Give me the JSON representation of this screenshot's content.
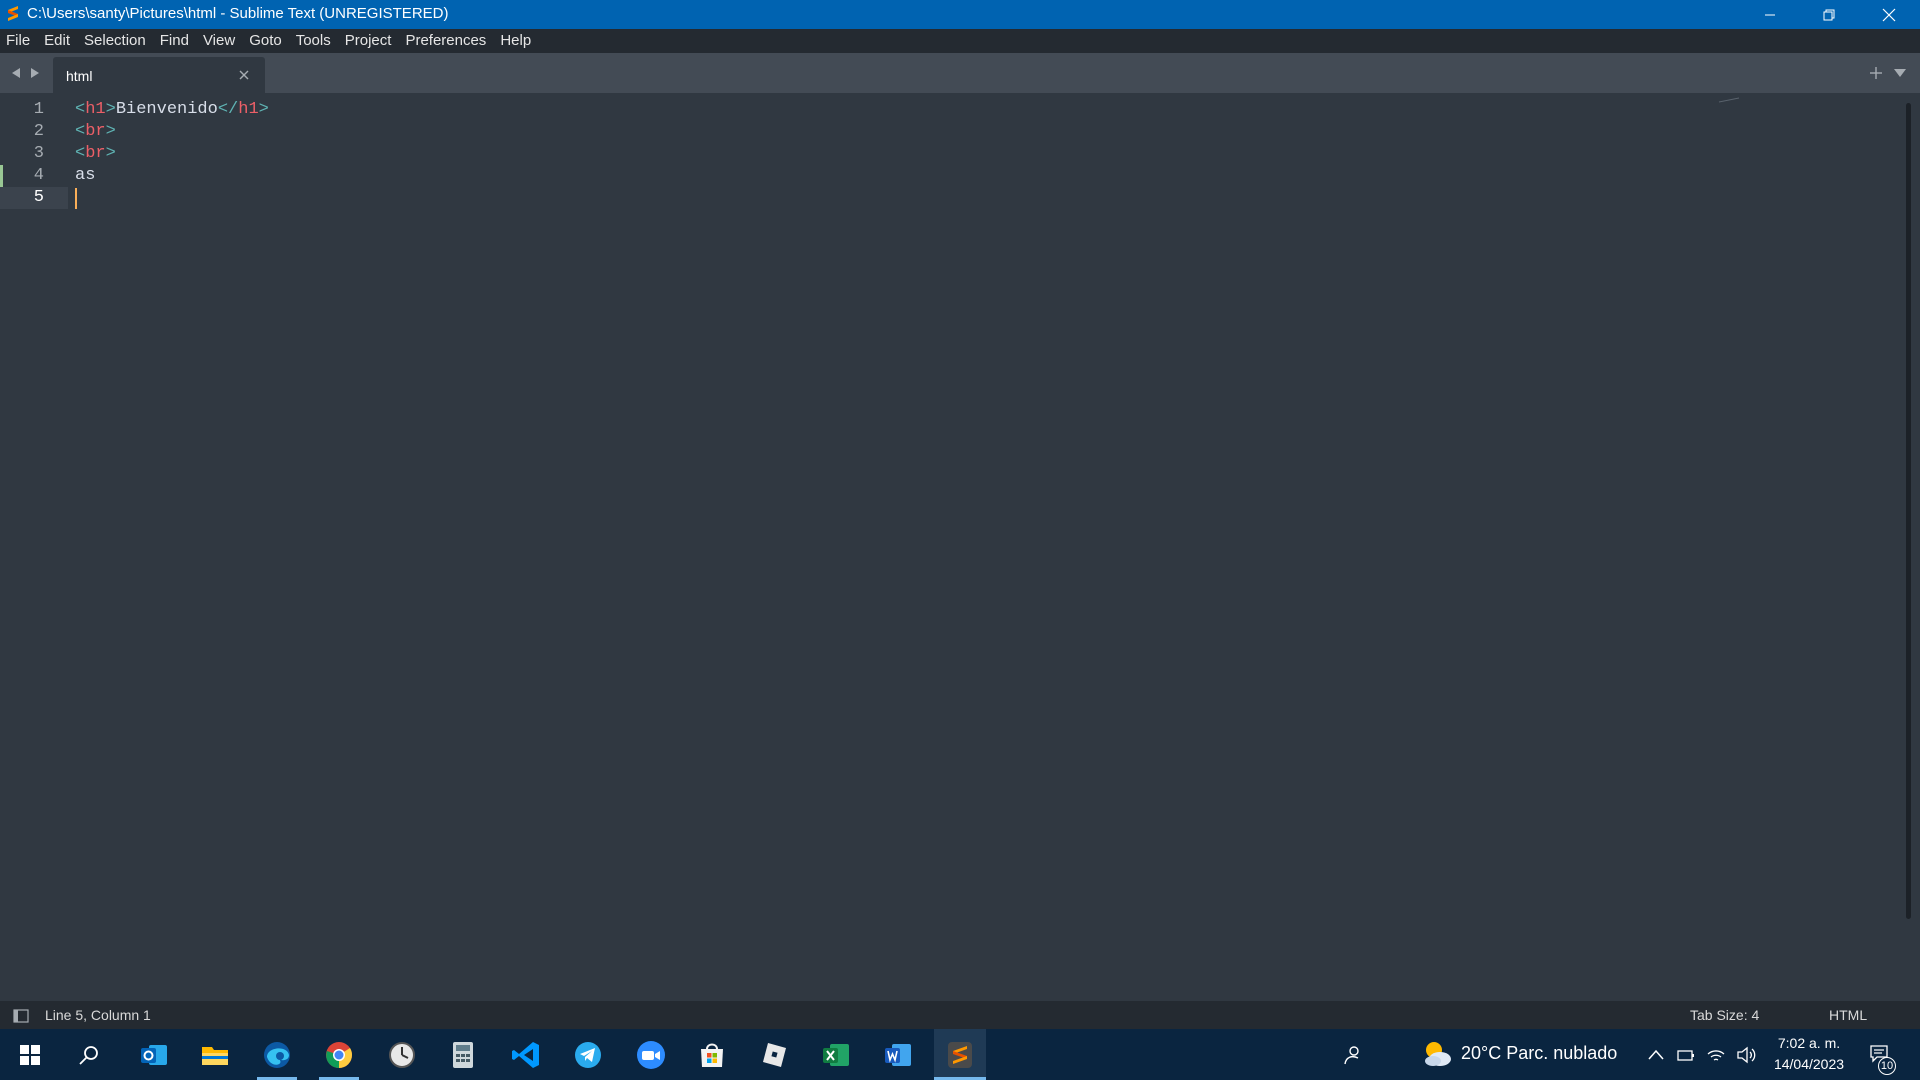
{
  "window": {
    "title": "C:\\Users\\santy\\Pictures\\html - Sublime Text (UNREGISTERED)"
  },
  "menu": {
    "items": [
      "File",
      "Edit",
      "Selection",
      "Find",
      "View",
      "Goto",
      "Tools",
      "Project",
      "Preferences",
      "Help"
    ]
  },
  "tabs": [
    {
      "label": "html",
      "active": true
    }
  ],
  "editor": {
    "line_numbers": [
      "1",
      "2",
      "3",
      "4",
      "5"
    ],
    "lines": [
      [
        {
          "t": "<",
          "k": "bracket"
        },
        {
          "t": "h1",
          "k": "tag"
        },
        {
          "t": ">",
          "k": "bracket"
        },
        {
          "t": "Bienvenido",
          "k": "text"
        },
        {
          "t": "</",
          "k": "bracket"
        },
        {
          "t": "h1",
          "k": "tag"
        },
        {
          "t": ">",
          "k": "bracket"
        }
      ],
      [
        {
          "t": "<",
          "k": "bracket"
        },
        {
          "t": "br",
          "k": "tag"
        },
        {
          "t": ">",
          "k": "bracket"
        }
      ],
      [
        {
          "t": "<",
          "k": "bracket"
        },
        {
          "t": "br",
          "k": "tag"
        },
        {
          "t": ">",
          "k": "bracket"
        }
      ],
      [
        {
          "t": "as",
          "k": "text"
        }
      ],
      []
    ],
    "active_line": 5,
    "colors": {
      "background": "#303841",
      "bracket": "#5fb3b3",
      "tag": "#ec5f67",
      "text": "#d8dee9",
      "caret": "#f9ae58",
      "modified": "#99c794"
    }
  },
  "statusbar": {
    "position": "Line 5, Column 1",
    "tab_size": "Tab Size: 4",
    "syntax": "HTML"
  },
  "taskbar": {
    "apps": [
      "windows-start",
      "search",
      "outlook",
      "file-explorer",
      "edge",
      "chrome",
      "clock",
      "calculator",
      "vscode",
      "telegram",
      "zoom",
      "microsoft-store",
      "roblox",
      "excel",
      "word",
      "sublime-text"
    ],
    "active_app": "sublime-text",
    "weather": "20°C  Parc. nublado",
    "time": "7:02 a. m.",
    "date": "14/04/2023",
    "notification_count": "10"
  }
}
